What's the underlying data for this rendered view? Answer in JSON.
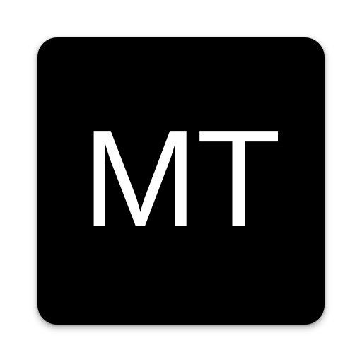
{
  "app_icon": {
    "monogram": "MT",
    "background_color": "#000000",
    "text_color": "#ffffff"
  }
}
